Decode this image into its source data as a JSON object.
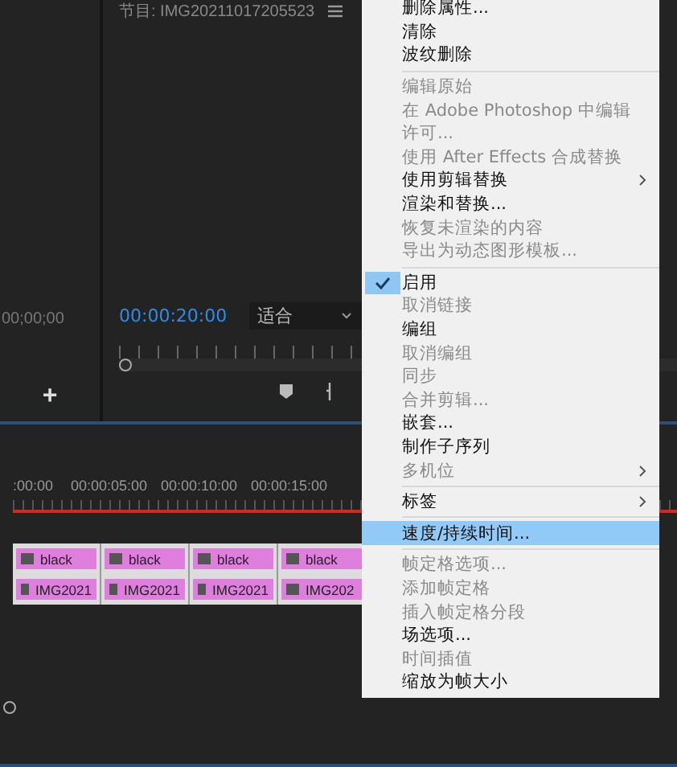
{
  "source_monitor": {
    "timecode": "00;00;00",
    "add_button": "+"
  },
  "program_monitor": {
    "title": "节目: IMG20211017205523",
    "timecode": "00:00:20:00",
    "zoom_dropdown": "适合"
  },
  "timeline": {
    "ruler_labels": [
      ":00:00",
      "00:00:05:00",
      "00:00:10:00",
      "00:00:15:00"
    ],
    "tracks": [
      {
        "clips": [
          "black",
          "black",
          "black",
          "black"
        ]
      },
      {
        "clips": [
          "IMG2021",
          "IMG2021",
          "IMG2021",
          "IMG202"
        ]
      }
    ]
  },
  "context_menu": [
    {
      "kind": "item",
      "label": "删除属性...",
      "disabled": false,
      "checked": false,
      "selected": false,
      "submenu": false
    },
    {
      "kind": "item",
      "label": "清除",
      "disabled": false,
      "checked": false,
      "selected": false,
      "submenu": false
    },
    {
      "kind": "item",
      "label": "波纹删除",
      "disabled": false,
      "checked": false,
      "selected": false,
      "submenu": false
    },
    {
      "kind": "separator"
    },
    {
      "kind": "item",
      "label": "编辑原始",
      "disabled": true,
      "checked": false,
      "selected": false,
      "submenu": false
    },
    {
      "kind": "item",
      "label": "在 Adobe Photoshop 中编辑",
      "disabled": true,
      "checked": false,
      "selected": false,
      "submenu": false
    },
    {
      "kind": "item",
      "label": "许可...",
      "disabled": true,
      "checked": false,
      "selected": false,
      "submenu": false
    },
    {
      "kind": "item",
      "label": "使用 After Effects 合成替换",
      "disabled": true,
      "checked": false,
      "selected": false,
      "submenu": false
    },
    {
      "kind": "item",
      "label": "使用剪辑替换",
      "disabled": false,
      "checked": false,
      "selected": false,
      "submenu": true
    },
    {
      "kind": "item",
      "label": "渲染和替换...",
      "disabled": false,
      "checked": false,
      "selected": false,
      "submenu": false
    },
    {
      "kind": "item",
      "label": "恢复未渲染的内容",
      "disabled": true,
      "checked": false,
      "selected": false,
      "submenu": false
    },
    {
      "kind": "item",
      "label": "导出为动态图形模板...",
      "disabled": true,
      "checked": false,
      "selected": false,
      "submenu": false
    },
    {
      "kind": "separator"
    },
    {
      "kind": "item",
      "label": "启用",
      "disabled": false,
      "checked": true,
      "selected": false,
      "submenu": false
    },
    {
      "kind": "item",
      "label": "取消链接",
      "disabled": true,
      "checked": false,
      "selected": false,
      "submenu": false
    },
    {
      "kind": "item",
      "label": "编组",
      "disabled": false,
      "checked": false,
      "selected": false,
      "submenu": false
    },
    {
      "kind": "item",
      "label": "取消编组",
      "disabled": true,
      "checked": false,
      "selected": false,
      "submenu": false
    },
    {
      "kind": "item",
      "label": "同步",
      "disabled": true,
      "checked": false,
      "selected": false,
      "submenu": false
    },
    {
      "kind": "item",
      "label": "合并剪辑...",
      "disabled": true,
      "checked": false,
      "selected": false,
      "submenu": false
    },
    {
      "kind": "item",
      "label": "嵌套...",
      "disabled": false,
      "checked": false,
      "selected": false,
      "submenu": false
    },
    {
      "kind": "item",
      "label": "制作子序列",
      "disabled": false,
      "checked": false,
      "selected": false,
      "submenu": false
    },
    {
      "kind": "item",
      "label": "多机位",
      "disabled": true,
      "checked": false,
      "selected": false,
      "submenu": true
    },
    {
      "kind": "separator"
    },
    {
      "kind": "item",
      "label": "标签",
      "disabled": false,
      "checked": false,
      "selected": false,
      "submenu": true
    },
    {
      "kind": "separator"
    },
    {
      "kind": "item",
      "label": "速度/持续时间...",
      "disabled": false,
      "checked": false,
      "selected": true,
      "submenu": false
    },
    {
      "kind": "separator"
    },
    {
      "kind": "item",
      "label": "帧定格选项...",
      "disabled": true,
      "checked": false,
      "selected": false,
      "submenu": false
    },
    {
      "kind": "item",
      "label": "添加帧定格",
      "disabled": true,
      "checked": false,
      "selected": false,
      "submenu": false
    },
    {
      "kind": "item",
      "label": "插入帧定格分段",
      "disabled": true,
      "checked": false,
      "selected": false,
      "submenu": false
    },
    {
      "kind": "item",
      "label": "场选项...",
      "disabled": false,
      "checked": false,
      "selected": false,
      "submenu": false
    },
    {
      "kind": "item",
      "label": "时间插值",
      "disabled": true,
      "checked": false,
      "selected": false,
      "submenu": false
    },
    {
      "kind": "item",
      "label": "缩放为帧大小",
      "disabled": false,
      "checked": false,
      "selected": false,
      "submenu": false
    }
  ]
}
